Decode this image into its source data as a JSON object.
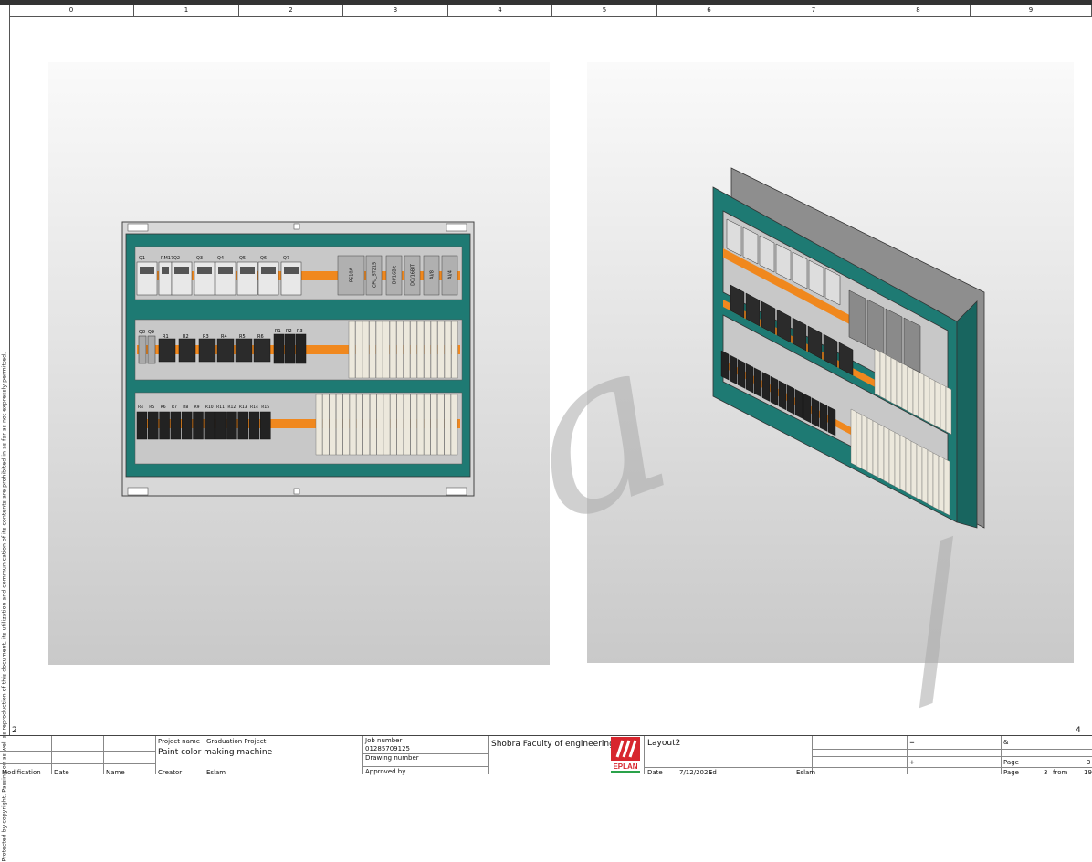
{
  "ruler": [
    "0",
    "1",
    "2",
    "3",
    "4",
    "5",
    "6",
    "7",
    "8",
    "9"
  ],
  "side_notice": "Protected by copyright. Passing on as well as reproduction of this document, its utilization and communication of its contents are prohibited in as far as not expressly permitted.",
  "page_marks": {
    "left": "2",
    "right": "4"
  },
  "front_view": {
    "row1_labels": [
      "Q1",
      "RM17",
      "Q2",
      "Q3",
      "Q4",
      "Q5",
      "Q6",
      "Q7"
    ],
    "row1_modules": [
      "PS10A",
      "CPU_ST215",
      "DI/16BIt",
      "DO/16BIT",
      "AI/8",
      "AI/4"
    ],
    "row2_labels": [
      "Q8",
      "Q9",
      "R1",
      "R2",
      "R3",
      "R4",
      "R5",
      "R6",
      "R1",
      "R2",
      "R3"
    ],
    "row3_labels": [
      "R4",
      "R5",
      "R6",
      "R7",
      "R8",
      "R9",
      "R10",
      "R11",
      "R12",
      "R13",
      "R14",
      "R15"
    ]
  },
  "colors": {
    "teal": "#1e7a73",
    "orange": "#f0881e",
    "grey": "#c8c8c8",
    "dark": "#333333"
  },
  "title_block": {
    "project_name_label": "Project name",
    "project_name": "Graduation Project",
    "project_desc": "Paint color making machine",
    "job_number_label": "Job number",
    "job_number": "01285709125",
    "drawing_number_label": "Drawing number",
    "approved_label": "Approved by",
    "modification_label": "Modification",
    "date_label": "Date",
    "name_label": "Name",
    "creator_label": "Creator",
    "creator": "Eslam",
    "company": "Shobra Faculty of engineering",
    "logo_text": "EPLAN",
    "sheet_title": "Layout2",
    "date_label2": "Date",
    "date_value": "7/12/2025",
    "ed_label": "Ed",
    "ed_name": "Eslam",
    "eq_mark": "=",
    "amp_mark": "&",
    "plus_mark": "+",
    "page_label": "Page",
    "page_value": "3",
    "page_from_label": "Page",
    "page_from": "3",
    "from_label": "from",
    "total_pages": "19"
  }
}
